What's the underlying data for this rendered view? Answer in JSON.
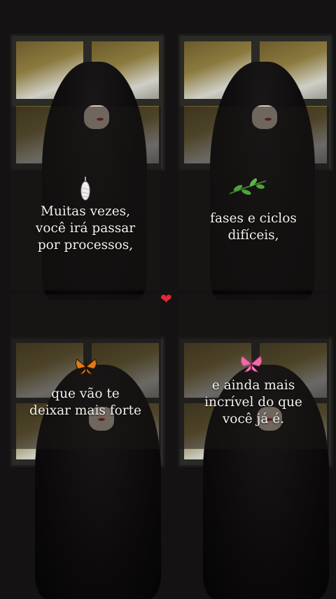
{
  "panels": [
    {
      "text_lines": [
        "Muitas vezes,",
        "você irá passar",
        "por processos,"
      ],
      "icon": "chrysalis-icon"
    },
    {
      "text_lines": [
        "fases e ciclos",
        "difíceis,"
      ],
      "icon": "leaf-branch-icon"
    },
    {
      "text_lines": [
        "que vão te",
        "deixar mais forte"
      ],
      "icon": "orange-butterfly-icon"
    },
    {
      "text_lines": [
        "e ainda mais",
        "incrível do que",
        "você já é."
      ],
      "icon": "pink-butterfly-icon"
    }
  ],
  "center_icon": "red-heart-icon",
  "colors": {
    "text": "#f4f0ea",
    "heart": "#e8262f",
    "butterfly_orange": "#e07a16",
    "butterfly_pink": "#f06aa8",
    "leaf": "#4ea43a"
  }
}
